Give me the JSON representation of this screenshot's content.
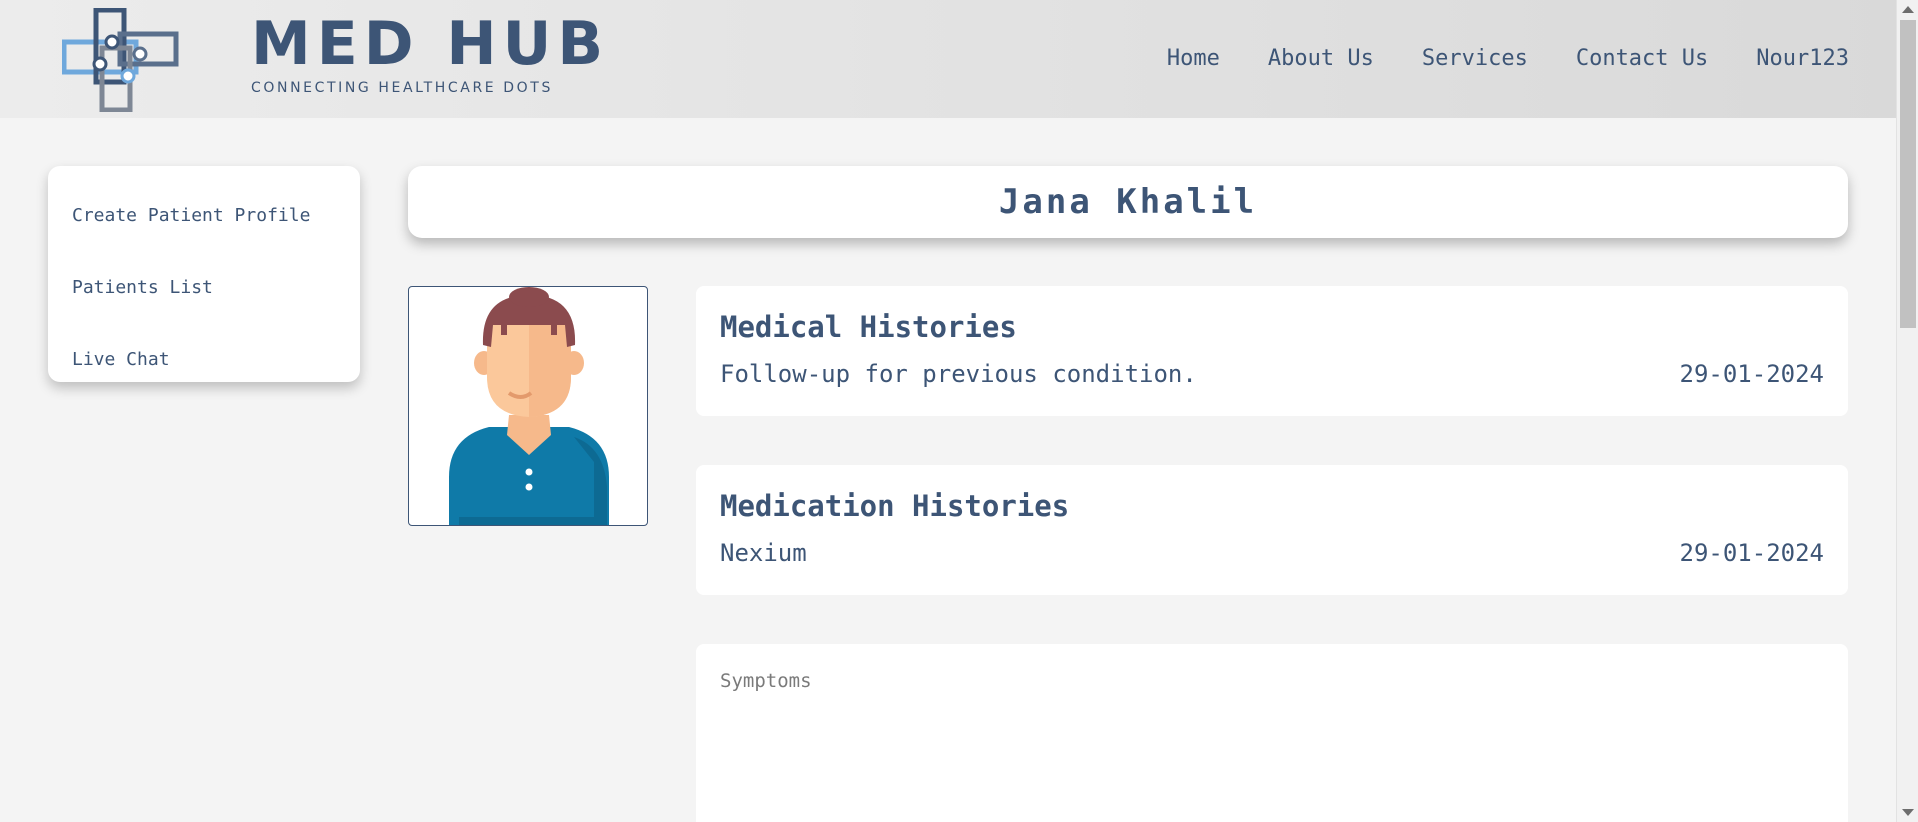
{
  "header": {
    "brand_name": "MED HUB",
    "brand_tagline": "CONNECTING HEALTHCARE DOTS",
    "nav": [
      "Home",
      "About Us",
      "Services",
      "Contact Us",
      "Nour123"
    ]
  },
  "sidebar": {
    "items": [
      {
        "label": "Create Patient Profile"
      },
      {
        "label": "Patients List"
      },
      {
        "label": "Live Chat"
      }
    ]
  },
  "patient": {
    "name": "Jana Khalil"
  },
  "medical_histories": {
    "title": "Medical Histories",
    "entry": "Follow-up for previous condition.",
    "date": "29-01-2024"
  },
  "medication_histories": {
    "title": "Medication Histories",
    "entry": "Nexium",
    "date": "29-01-2024"
  },
  "symptoms": {
    "placeholder": "Symptoms",
    "value": ""
  },
  "colors": {
    "primary": "#3d5576",
    "accent_light": "#6fa8dc",
    "background": "#f4f4f4",
    "avatar_shirt": "#0f7aa8"
  }
}
